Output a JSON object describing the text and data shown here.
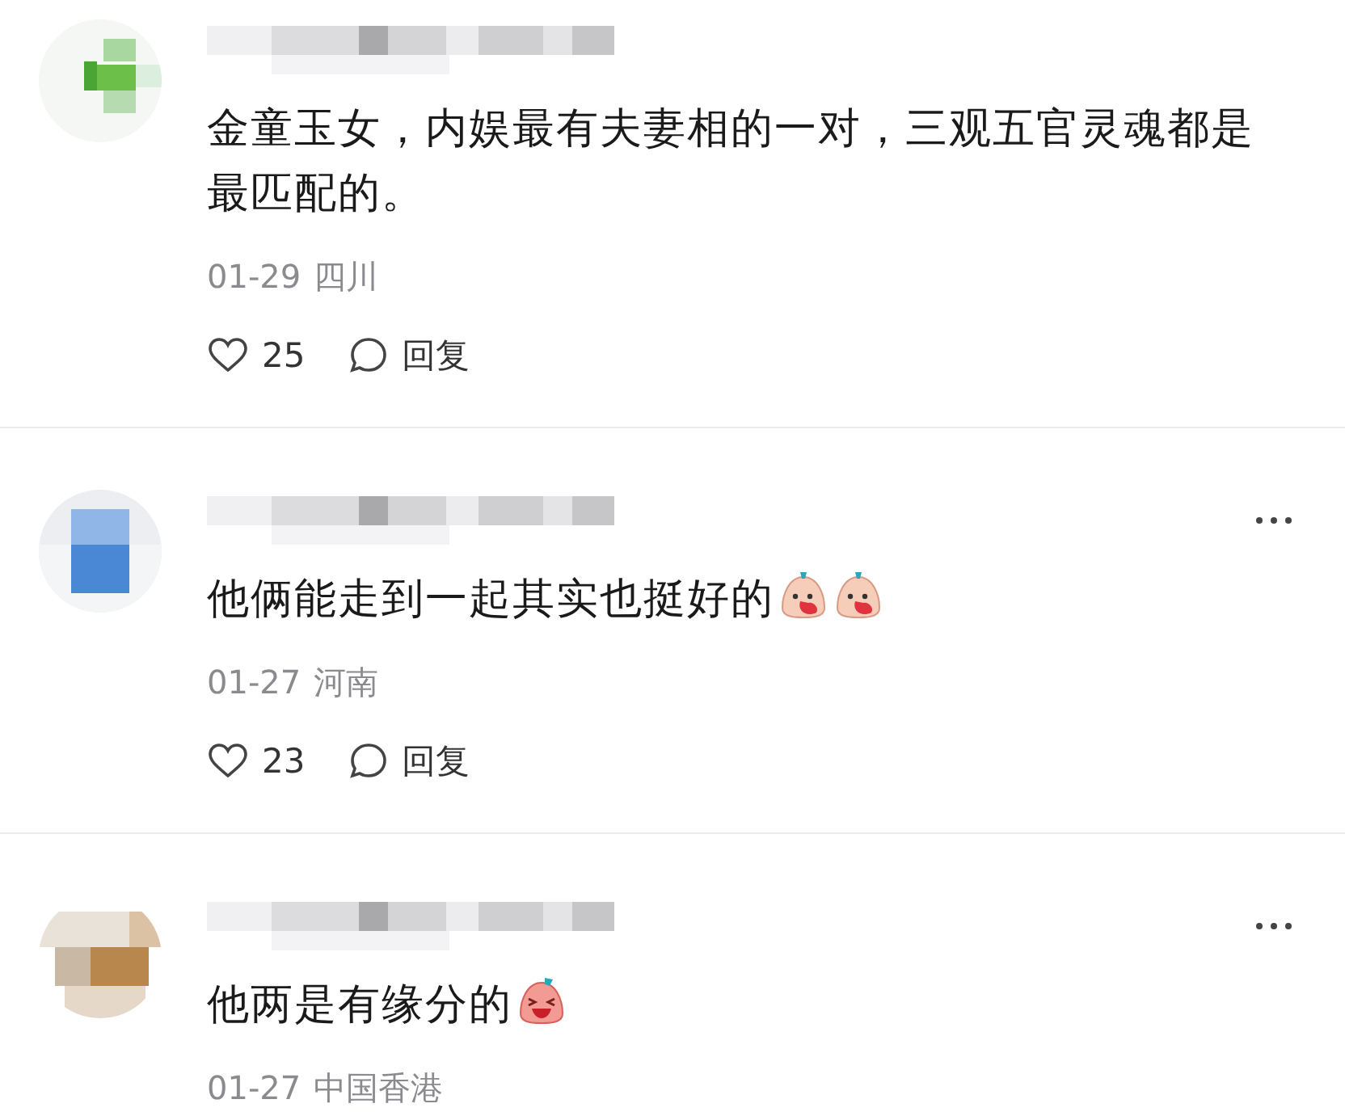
{
  "comments": [
    {
      "avatar": {
        "kind": "green"
      },
      "more_button": false,
      "text": "金童玉女，内娱最有夫妻相的一对，三观五官灵魂都是最匹配的。",
      "date": "01-29",
      "location": "四川",
      "likes": "25",
      "reply": "回复"
    },
    {
      "avatar": {
        "kind": "blue"
      },
      "more_button": true,
      "text": "他俩能走到一起其实也挺好的",
      "emojis": [
        {
          "kind": "shy"
        },
        {
          "kind": "shy"
        }
      ],
      "date": "01-27",
      "location": "河南",
      "likes": "23",
      "reply": "回复"
    },
    {
      "avatar": {
        "kind": "brown"
      },
      "more_button": true,
      "text": "他两是有缘分的",
      "emojis": [
        {
          "kind": "laugh"
        }
      ],
      "date": "01-27",
      "location": "中国香港"
    }
  ]
}
